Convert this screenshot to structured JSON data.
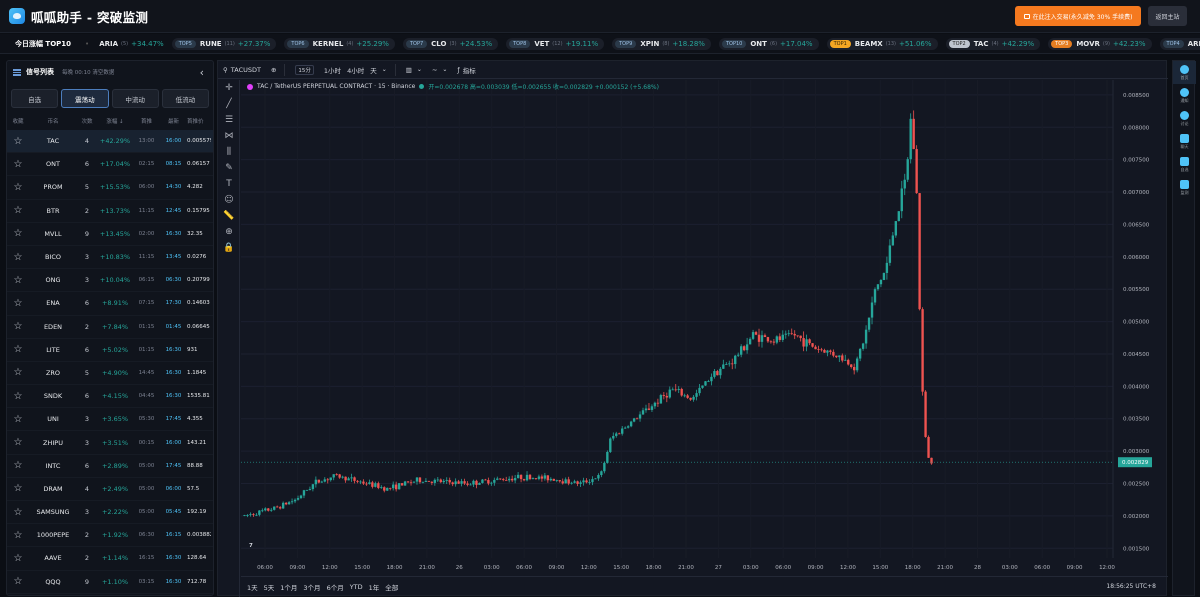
{
  "app": {
    "title": "呱呱助手 - 突破监测",
    "promo_label": "在此注入交易(永久减免 30% 手续费)",
    "home_label": "返回主站"
  },
  "ticker": {
    "title": "今日涨幅 TOP10",
    "items": [
      {
        "rank": "",
        "symbol": "ARIA",
        "count": "(5)",
        "change": "+34.47%",
        "pill": false
      },
      {
        "rank": "TOP5",
        "symbol": "RUNE",
        "count": "(11)",
        "change": "+27.37%",
        "pill": true,
        "badge": ""
      },
      {
        "rank": "TOP6",
        "symbol": "KERNEL",
        "count": "(4)",
        "change": "+25.29%",
        "pill": true,
        "badge": ""
      },
      {
        "rank": "TOP7",
        "symbol": "CLO",
        "count": "(3)",
        "change": "+24.53%",
        "pill": true,
        "badge": ""
      },
      {
        "rank": "TOP8",
        "symbol": "VET",
        "count": "(12)",
        "change": "+19.11%",
        "pill": true,
        "badge": ""
      },
      {
        "rank": "TOP9",
        "symbol": "XPIN",
        "count": "(8)",
        "change": "+18.28%",
        "pill": true,
        "badge": ""
      },
      {
        "rank": "TOP10",
        "symbol": "ONT",
        "count": "(6)",
        "change": "+17.04%",
        "pill": true,
        "badge": ""
      },
      {
        "rank": "TOP1",
        "symbol": "BEAMX",
        "count": "(13)",
        "change": "+51.06%",
        "pill": true,
        "badge": "gold"
      },
      {
        "rank": "TOP2",
        "symbol": "TAC",
        "count": "(4)",
        "change": "+42.29%",
        "pill": true,
        "badge": "silver"
      },
      {
        "rank": "TOP3",
        "symbol": "MOVR",
        "count": "(9)",
        "change": "+42.23%",
        "pill": true,
        "badge": "orange"
      },
      {
        "rank": "TOP4",
        "symbol": "ARIA",
        "count": "(5)",
        "change": "+34.47%",
        "pill": true,
        "badge": ""
      }
    ]
  },
  "signals": {
    "title": "信号列表",
    "subtitle": "每晚 00:10 清空数据",
    "tabs": [
      "自选",
      "震荡动",
      "中流动",
      "低流动"
    ],
    "active_tab": 1,
    "columns": [
      "收藏",
      "币名",
      "次数",
      "涨幅 ↓",
      "首推",
      "最新",
      "首推价"
    ],
    "rows": [
      {
        "sym": "TAC",
        "cnt": "4",
        "chg": "+42.29%",
        "t1": "13:00",
        "t2": "16:00",
        "px": "0.005579"
      },
      {
        "sym": "ONT",
        "cnt": "6",
        "chg": "+17.04%",
        "t1": "02:15",
        "t2": "08:15",
        "px": "0.06157"
      },
      {
        "sym": "PROM",
        "cnt": "5",
        "chg": "+15.53%",
        "t1": "06:00",
        "t2": "14:30",
        "px": "4.282"
      },
      {
        "sym": "BTR",
        "cnt": "2",
        "chg": "+13.73%",
        "t1": "11:15",
        "t2": "12:45",
        "px": "0.15795"
      },
      {
        "sym": "MVLL",
        "cnt": "9",
        "chg": "+13.45%",
        "t1": "02:00",
        "t2": "16:30",
        "px": "32.35"
      },
      {
        "sym": "BICO",
        "cnt": "3",
        "chg": "+10.83%",
        "t1": "11:15",
        "t2": "13:45",
        "px": "0.0276"
      },
      {
        "sym": "ONG",
        "cnt": "3",
        "chg": "+10.04%",
        "t1": "06:15",
        "t2": "06:30",
        "px": "0.20799"
      },
      {
        "sym": "ENA",
        "cnt": "6",
        "chg": "+8.91%",
        "t1": "07:15",
        "t2": "17:30",
        "px": "0.14603"
      },
      {
        "sym": "EDEN",
        "cnt": "2",
        "chg": "+7.84%",
        "t1": "01:15",
        "t2": "01:45",
        "px": "0.06645"
      },
      {
        "sym": "LITE",
        "cnt": "6",
        "chg": "+5.02%",
        "t1": "01:15",
        "t2": "16:30",
        "px": "931"
      },
      {
        "sym": "ZRO",
        "cnt": "5",
        "chg": "+4.90%",
        "t1": "14:45",
        "t2": "16:30",
        "px": "1.1845"
      },
      {
        "sym": "SNDK",
        "cnt": "6",
        "chg": "+4.15%",
        "t1": "04:45",
        "t2": "16:30",
        "px": "1535.81"
      },
      {
        "sym": "UNI",
        "cnt": "3",
        "chg": "+3.65%",
        "t1": "05:30",
        "t2": "17:45",
        "px": "4.355"
      },
      {
        "sym": "ZHIPU",
        "cnt": "3",
        "chg": "+3.51%",
        "t1": "00:15",
        "t2": "16:00",
        "px": "143.21"
      },
      {
        "sym": "INTC",
        "cnt": "6",
        "chg": "+2.89%",
        "t1": "05:00",
        "t2": "17:45",
        "px": "88.88"
      },
      {
        "sym": "DRAM",
        "cnt": "4",
        "chg": "+2.49%",
        "t1": "05:00",
        "t2": "06:00",
        "px": "57.5"
      },
      {
        "sym": "SAMSUNG",
        "cnt": "3",
        "chg": "+2.22%",
        "t1": "05:00",
        "t2": "05:45",
        "px": "192.19"
      },
      {
        "sym": "1000PEPE",
        "cnt": "2",
        "chg": "+1.92%",
        "t1": "06:30",
        "t2": "16:15",
        "px": "0.003882"
      },
      {
        "sym": "AAVE",
        "cnt": "2",
        "chg": "+1.14%",
        "t1": "16:15",
        "t2": "16:30",
        "px": "128.64"
      },
      {
        "sym": "QQQ",
        "cnt": "9",
        "chg": "+1.10%",
        "t1": "03:15",
        "t2": "16:30",
        "px": "712.78"
      }
    ]
  },
  "chart_toolbar": {
    "symbol": "TACUSDT",
    "interval_box": "15分",
    "tf1": "1小时",
    "tf2": "4小时",
    "tf3": "天",
    "indicators": "指标"
  },
  "chart_legend": {
    "title": "TAC / TetherUS PERPETUAL CONTRACT · 15 · Binance",
    "ohlc": "开=0.002678  高=0.003039  低=0.002655  收=0.002829  +0.000152 (+5.68%)"
  },
  "range_bar": {
    "ranges": [
      "1天",
      "5天",
      "1个月",
      "3个月",
      "6个月",
      "YTD",
      "1年",
      "全部"
    ],
    "clock": "18:56:25 UTC+8"
  },
  "right_rail": [
    "首页",
    "通知",
    "讨论",
    "聊天",
    "自选",
    "监测"
  ],
  "chart_data": {
    "type": "candlestick",
    "title": "TAC / TetherUS PERPETUAL CONTRACT · 15 · Binance",
    "x_ticks": [
      "06:00",
      "09:00",
      "12:00",
      "15:00",
      "18:00",
      "21:00",
      "26",
      "03:00",
      "06:00",
      "09:00",
      "12:00",
      "15:00",
      "18:00",
      "21:00",
      "27",
      "03:00",
      "06:00",
      "09:00",
      "12:00",
      "15:00",
      "18:00",
      "21:00",
      "28",
      "03:00",
      "06:00",
      "09:00",
      "12:00"
    ],
    "y_ticks": [
      0.0015,
      0.002,
      0.0025,
      0.003,
      0.0035,
      0.004,
      0.0045,
      0.005,
      0.0055,
      0.006,
      0.0065,
      0.007,
      0.0075,
      0.008,
      0.0085
    ],
    "y_tick_labels": [
      "0.001500",
      "0.002000",
      "0.002500",
      "0.003000",
      "0.003500",
      "0.004000",
      "0.004500",
      "0.005000",
      "0.005500",
      "0.006000",
      "0.006500",
      "0.007000",
      "0.007500",
      "0.008000",
      "0.008500"
    ],
    "ylim": [
      0.00135,
      0.00873
    ],
    "last_price": "0.002829",
    "last_value": 0.002829,
    "path": [
      [
        0,
        0.002
      ],
      [
        6,
        0.00212
      ],
      [
        10,
        0.00225
      ],
      [
        14,
        0.00252
      ],
      [
        18,
        0.00262
      ],
      [
        28,
        0.00242
      ],
      [
        34,
        0.00255
      ],
      [
        44,
        0.0025
      ],
      [
        54,
        0.0026
      ],
      [
        60,
        0.00258
      ],
      [
        66,
        0.0025
      ],
      [
        70,
        0.00262
      ],
      [
        72,
        0.0032
      ],
      [
        76,
        0.00345
      ],
      [
        80,
        0.0037
      ],
      [
        84,
        0.00395
      ],
      [
        88,
        0.0038
      ],
      [
        92,
        0.0042
      ],
      [
        96,
        0.0044
      ],
      [
        100,
        0.0048
      ],
      [
        104,
        0.0047
      ],
      [
        108,
        0.0048
      ],
      [
        112,
        0.0046
      ],
      [
        116,
        0.0045
      ],
      [
        120,
        0.0043
      ],
      [
        122,
        0.0048
      ],
      [
        124,
        0.0055
      ],
      [
        126,
        0.0058
      ],
      [
        128,
        0.0066
      ],
      [
        130,
        0.0072
      ],
      [
        131,
        0.0082
      ],
      [
        132,
        0.0072
      ],
      [
        133,
        0.0042
      ],
      [
        134,
        0.003
      ],
      [
        135,
        0.0028
      ]
    ]
  }
}
